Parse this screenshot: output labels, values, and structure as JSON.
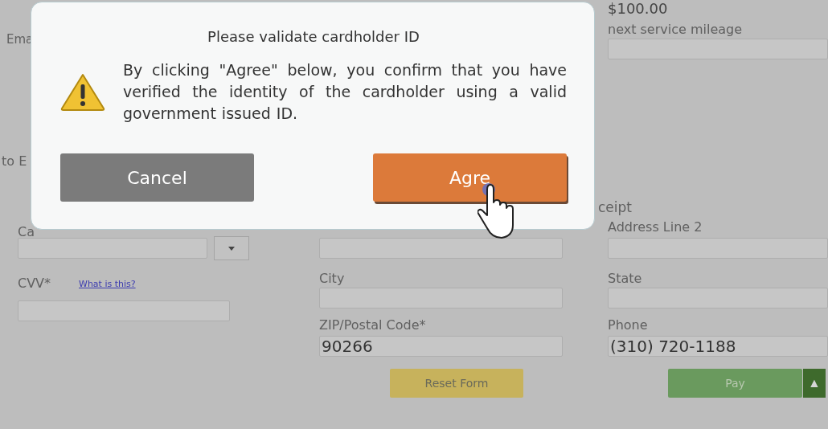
{
  "form": {
    "top_amount": "$100.00",
    "email_label": "Ema",
    "mileage": {
      "label": "next service mileage"
    },
    "section_label": "to E",
    "receipt_label": "ceipt",
    "card": {
      "label": "Ca"
    },
    "cvv": {
      "label": "CVV*",
      "help_link": "What is this?"
    },
    "address_line_2": {
      "label": "Address Line 2"
    },
    "city": {
      "label": "City"
    },
    "state": {
      "label": "State"
    },
    "zip": {
      "label": "ZIP/Postal Code*",
      "value": "90266"
    },
    "phone": {
      "label": "Phone",
      "value": "(310) 720-1188"
    },
    "buttons": [
      {
        "label": "Reset Form",
        "kind": "reset"
      },
      {
        "label": "Pay",
        "kind": "pay"
      }
    ],
    "scroll_top": "▲"
  },
  "dialog": {
    "title": "Please validate cardholder ID",
    "message": "By clicking \"Agree\" below, you confirm that you have verified the identity of the cardholder using a valid government issued ID.",
    "buttons": [
      {
        "label": "Cancel",
        "kind": "secondary"
      },
      {
        "label": "Agre",
        "kind": "primary"
      }
    ]
  }
}
